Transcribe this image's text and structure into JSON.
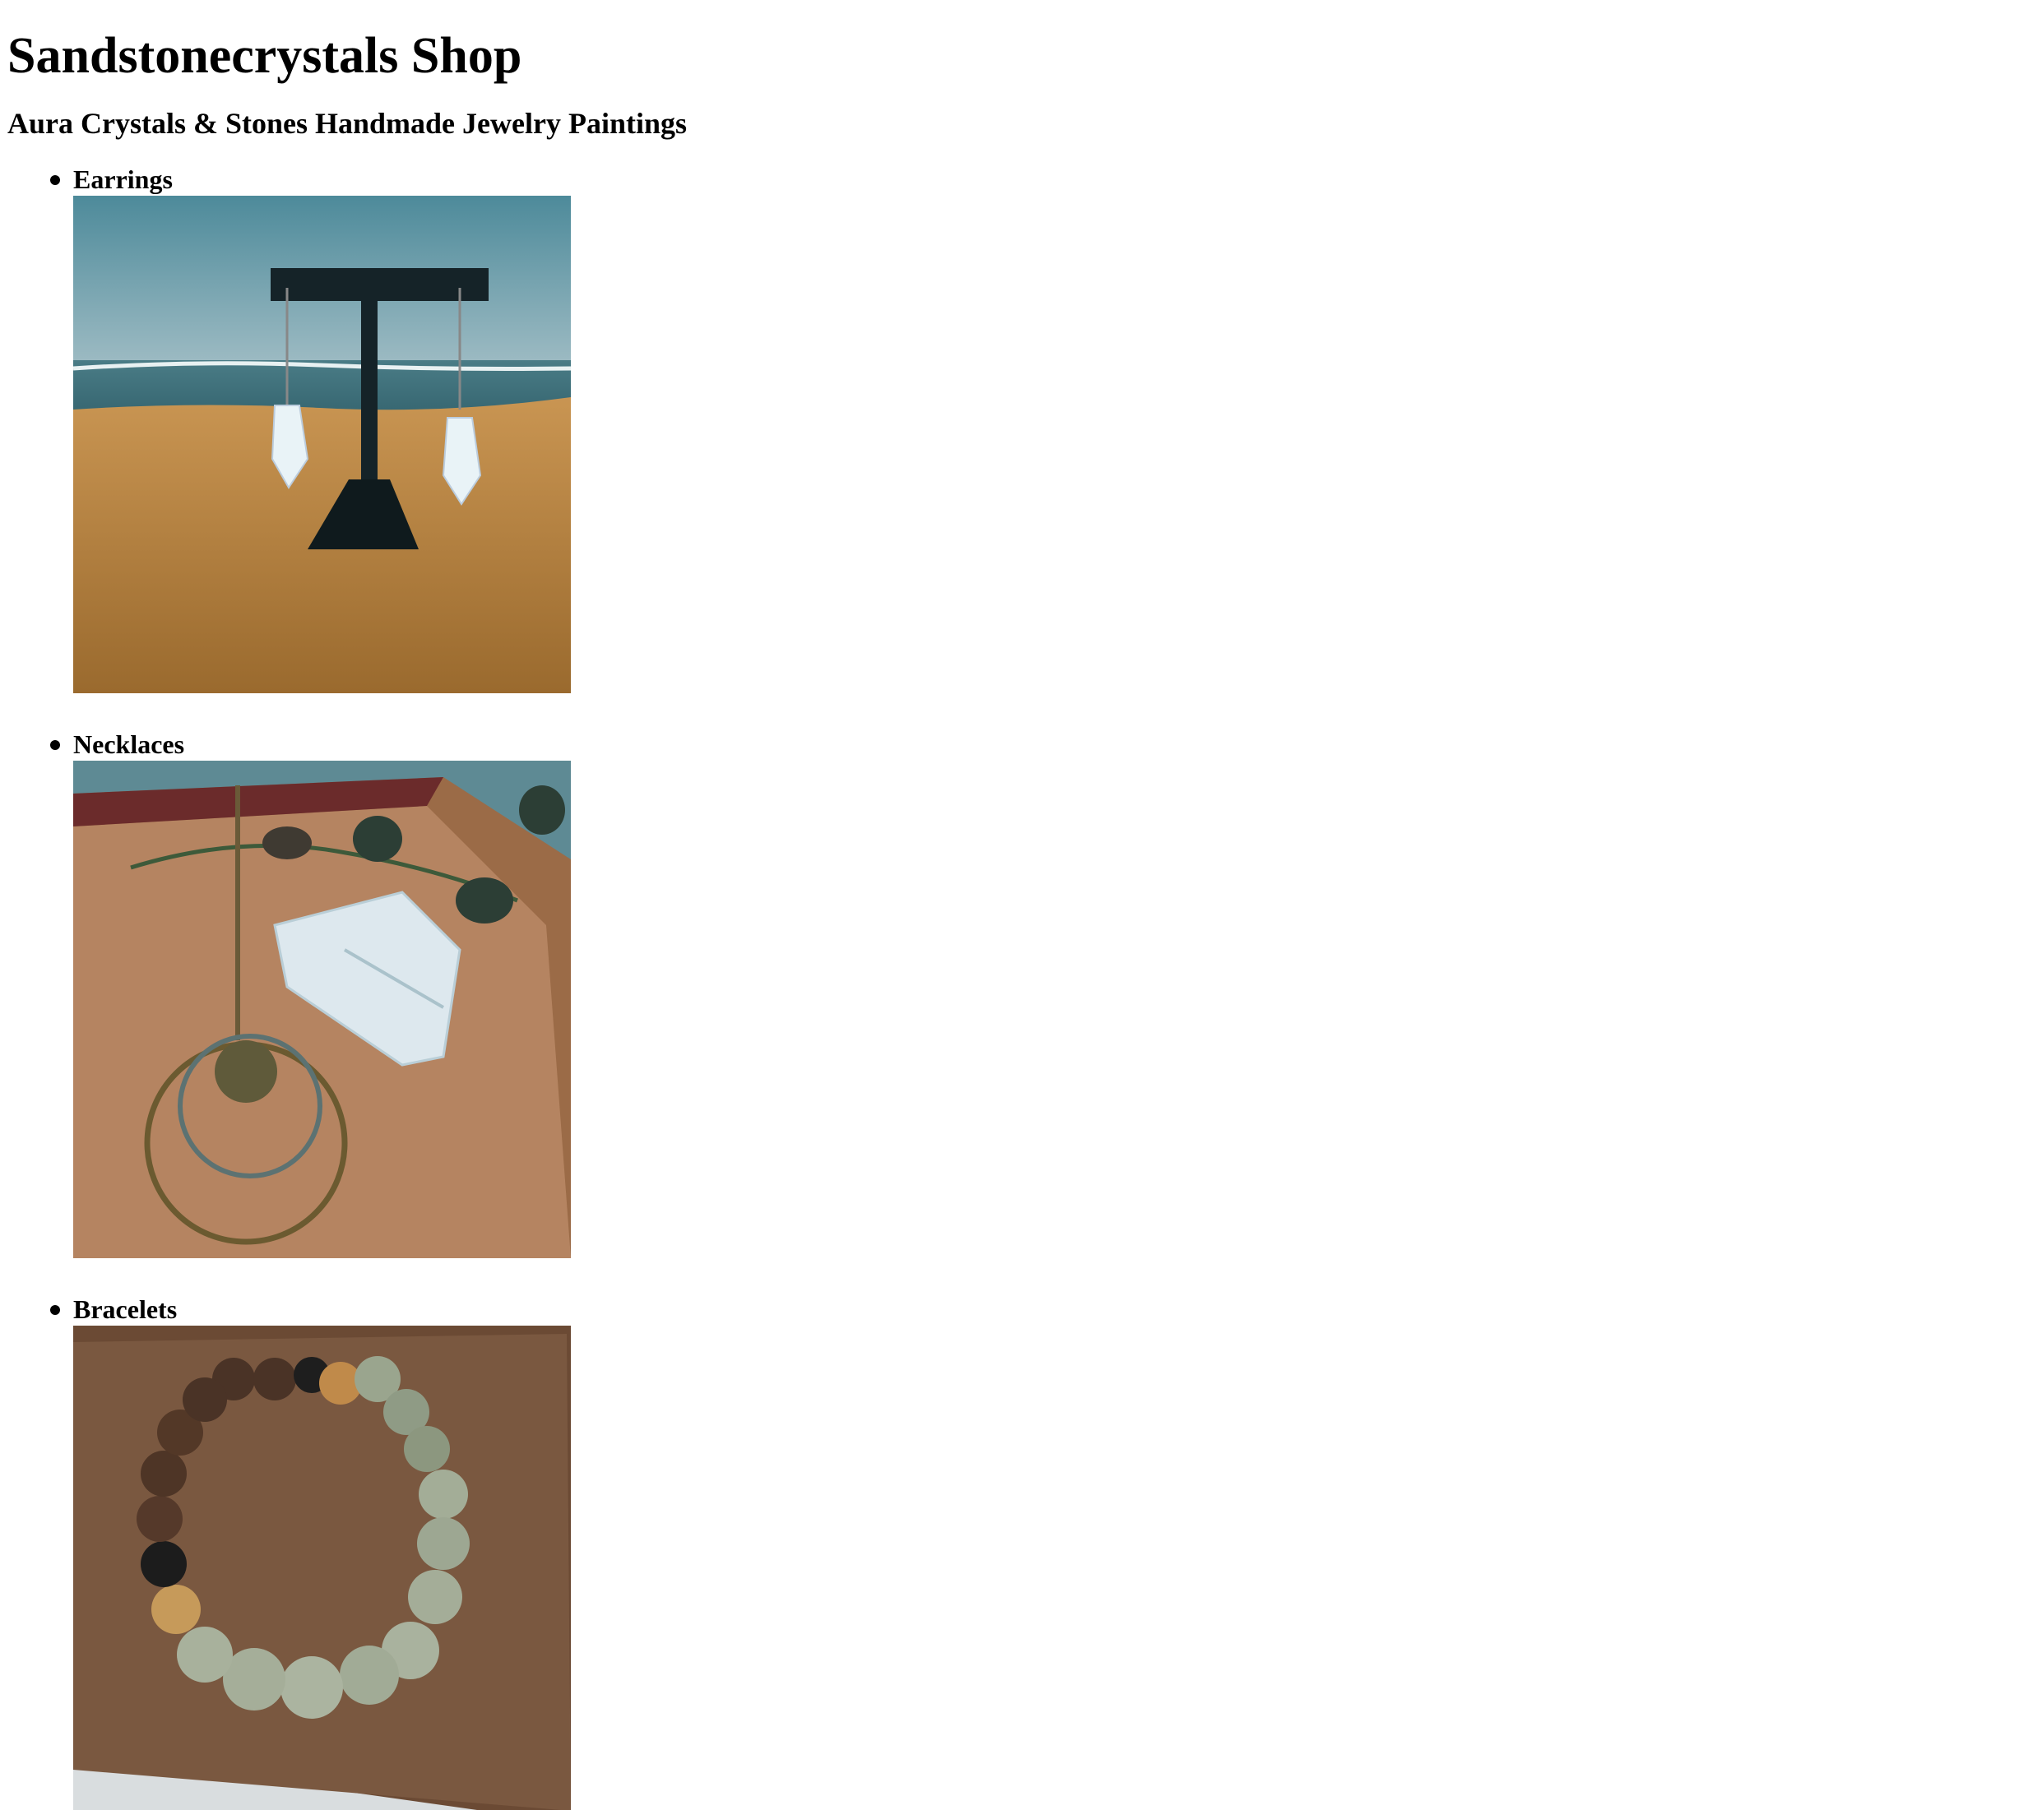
{
  "site": {
    "title": "Sandstonecrystals Shop",
    "tagline": "Aura Crystals & Stones Handmade Jewelry Paintings"
  },
  "categories": [
    {
      "label": "Earrings"
    },
    {
      "label": "Necklaces"
    },
    {
      "label": "Bracelets"
    }
  ]
}
